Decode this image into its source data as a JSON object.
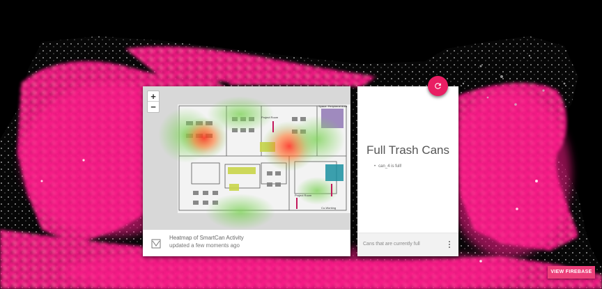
{
  "colors": {
    "accent": "#e91e63",
    "map_glow": "#ff1e8c",
    "background": "#000000"
  },
  "heatmap_card": {
    "zoom_in": "+",
    "zoom_out": "−",
    "footer_icon": "heatmap-image-icon",
    "title": "Heatmap of SmartCan Activity",
    "subtitle": "updated a few moments ago",
    "floorplan_labels": {
      "project_room": "Project Room",
      "project_room_2": "Project Room",
      "cowork": "Co-Working",
      "space_top": "Space: Peripheral Area"
    }
  },
  "trash_card": {
    "title": "Full Trash Cans",
    "items": [
      "can_4 is full!"
    ],
    "footer_text": "Cans that are currently full",
    "more_icon": "more-vert-icon",
    "refresh_icon": "refresh-icon"
  },
  "view_firebase_button": "VIEW FIREBASE"
}
